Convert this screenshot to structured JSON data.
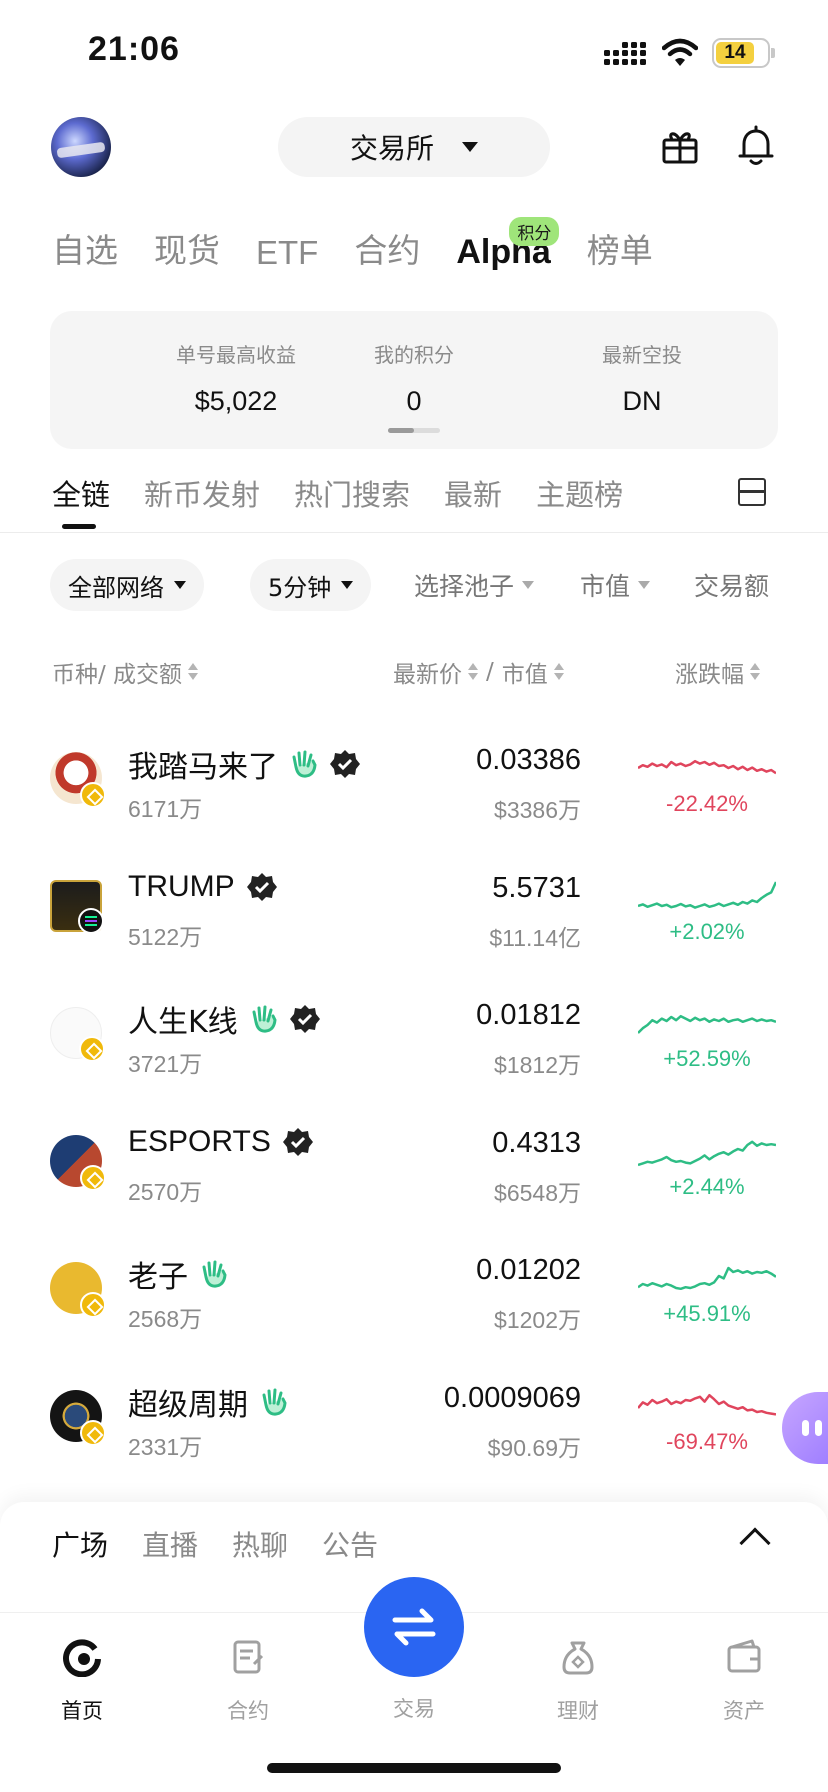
{
  "status_bar": {
    "time": "21:06",
    "battery": "14"
  },
  "header": {
    "exchange_label": "交易所"
  },
  "category_tabs": [
    {
      "label": "自选",
      "active": false
    },
    {
      "label": "现货",
      "active": false
    },
    {
      "label": "ETF",
      "active": false
    },
    {
      "label": "合约",
      "active": false
    },
    {
      "label": "Alpha",
      "active": true,
      "badge": "积分"
    },
    {
      "label": "榜单",
      "active": false
    }
  ],
  "summary": {
    "max_profit_label": "单号最高收益",
    "max_profit_value": "$5,022",
    "points_label": "我的积分",
    "points_value": "0",
    "airdrop_label": "最新空投",
    "airdrop_value": "DN"
  },
  "sub_tabs": [
    {
      "label": "全链",
      "active": true
    },
    {
      "label": "新币发射",
      "active": false
    },
    {
      "label": "热门搜索",
      "active": false
    },
    {
      "label": "最新",
      "active": false
    },
    {
      "label": "主题榜",
      "active": false
    }
  ],
  "filters": {
    "network": "全部网络",
    "interval": "5分钟",
    "pool": "选择池子",
    "mcap": "市值",
    "volume": "交易额"
  },
  "columns": {
    "coin": "币种/ 成交额",
    "price": "最新价",
    "separator": "/",
    "mcap": "市值",
    "change": "涨跌幅"
  },
  "coins": [
    {
      "name": "我踏马来了",
      "volume": "6171万",
      "price": "0.03386",
      "mcap": "$3386万",
      "change": "-22.42%",
      "trend": "down",
      "hand": true,
      "verified": true,
      "chain": "bnb",
      "spark": [
        0.55,
        0.62,
        0.58,
        0.66,
        0.6,
        0.64,
        0.57,
        0.7,
        0.62,
        0.66,
        0.6,
        0.64,
        0.72,
        0.66,
        0.7,
        0.63,
        0.68,
        0.6,
        0.62,
        0.55,
        0.6,
        0.52,
        0.58,
        0.5,
        0.56,
        0.48,
        0.52,
        0.46,
        0.5,
        0.42
      ]
    },
    {
      "name": "TRUMP",
      "volume": "5122万",
      "price": "5.5731",
      "mcap": "$11.14亿",
      "change": "+2.02%",
      "trend": "up",
      "hand": false,
      "verified": true,
      "chain": "sol",
      "spark": [
        0.3,
        0.34,
        0.28,
        0.32,
        0.36,
        0.3,
        0.33,
        0.27,
        0.3,
        0.35,
        0.29,
        0.32,
        0.26,
        0.3,
        0.34,
        0.28,
        0.31,
        0.36,
        0.3,
        0.34,
        0.38,
        0.33,
        0.4,
        0.36,
        0.44,
        0.4,
        0.5,
        0.58,
        0.64,
        0.9
      ]
    },
    {
      "name": "人生K线",
      "volume": "3721万",
      "price": "0.01812",
      "mcap": "$1812万",
      "change": "+52.59%",
      "trend": "up",
      "hand": true,
      "verified": true,
      "chain": "bnb",
      "spark": [
        0.3,
        0.42,
        0.5,
        0.62,
        0.56,
        0.66,
        0.6,
        0.7,
        0.62,
        0.72,
        0.66,
        0.6,
        0.68,
        0.62,
        0.66,
        0.58,
        0.64,
        0.6,
        0.66,
        0.58,
        0.62,
        0.64,
        0.58,
        0.62,
        0.66,
        0.6,
        0.64,
        0.6,
        0.62,
        0.58
      ]
    },
    {
      "name": "ESPORTS",
      "volume": "2570万",
      "price": "0.4313",
      "mcap": "$6548万",
      "change": "+2.44%",
      "trend": "up",
      "hand": false,
      "verified": true,
      "chain": "bnb",
      "spark": [
        0.2,
        0.24,
        0.28,
        0.26,
        0.3,
        0.34,
        0.4,
        0.32,
        0.28,
        0.3,
        0.26,
        0.24,
        0.3,
        0.36,
        0.44,
        0.34,
        0.42,
        0.48,
        0.52,
        0.46,
        0.54,
        0.6,
        0.56,
        0.7,
        0.78,
        0.68,
        0.74,
        0.7,
        0.72,
        0.7
      ]
    },
    {
      "name": "老子",
      "volume": "2568万",
      "price": "0.01202",
      "mcap": "$1202万",
      "change": "+45.91%",
      "trend": "up",
      "hand": true,
      "verified": false,
      "chain": "bnb",
      "spark": [
        0.32,
        0.4,
        0.36,
        0.42,
        0.38,
        0.34,
        0.4,
        0.36,
        0.3,
        0.28,
        0.32,
        0.3,
        0.34,
        0.4,
        0.42,
        0.38,
        0.44,
        0.6,
        0.54,
        0.8,
        0.7,
        0.74,
        0.68,
        0.72,
        0.66,
        0.7,
        0.68,
        0.72,
        0.66,
        0.58
      ]
    },
    {
      "name": "超级周期",
      "volume": "2331万",
      "price": "0.0009069",
      "mcap": "$90.69万",
      "change": "-69.47%",
      "trend": "down",
      "hand": true,
      "verified": false,
      "chain": "bnb",
      "spark": [
        0.5,
        0.64,
        0.58,
        0.7,
        0.62,
        0.66,
        0.72,
        0.6,
        0.66,
        0.62,
        0.7,
        0.68,
        0.74,
        0.78,
        0.66,
        0.82,
        0.72,
        0.6,
        0.66,
        0.56,
        0.52,
        0.48,
        0.52,
        0.44,
        0.46,
        0.4,
        0.42,
        0.38,
        0.36,
        0.34
      ]
    }
  ],
  "colors": {
    "down": "#e0455d",
    "up": "#2ebd85",
    "trade": "#2a65f2"
  },
  "sheet_tabs": [
    {
      "label": "广场",
      "active": true
    },
    {
      "label": "直播",
      "active": false
    },
    {
      "label": "热聊",
      "active": false
    },
    {
      "label": "公告",
      "active": false
    }
  ],
  "bottom_nav": {
    "home": "首页",
    "futures": "合约",
    "trade": "交易",
    "earn": "理财",
    "assets": "资产"
  }
}
